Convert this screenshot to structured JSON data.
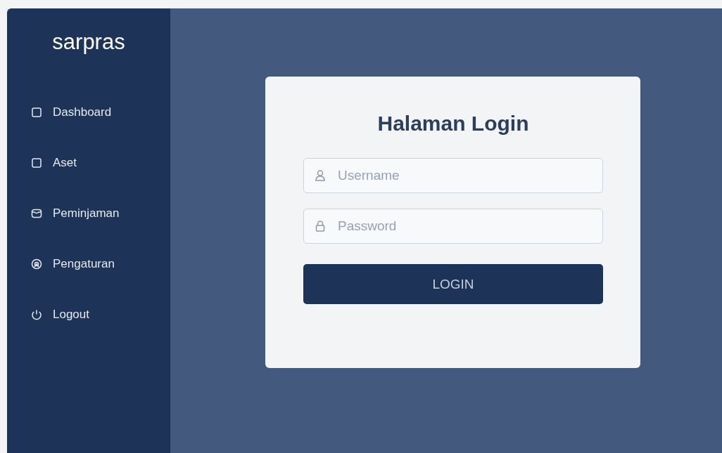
{
  "sidebar": {
    "logo": "sarpras",
    "items": [
      {
        "label": "Dashboard"
      },
      {
        "label": "Aset"
      },
      {
        "label": "Peminjaman"
      },
      {
        "label": "Pengaturan"
      },
      {
        "label": "Logout"
      }
    ]
  },
  "login": {
    "title": "Halaman Login",
    "fields": [
      {
        "kind": "user",
        "placeholder": "Username"
      },
      {
        "kind": "password",
        "placeholder": "Password"
      }
    ],
    "button": "LOGIN"
  }
}
